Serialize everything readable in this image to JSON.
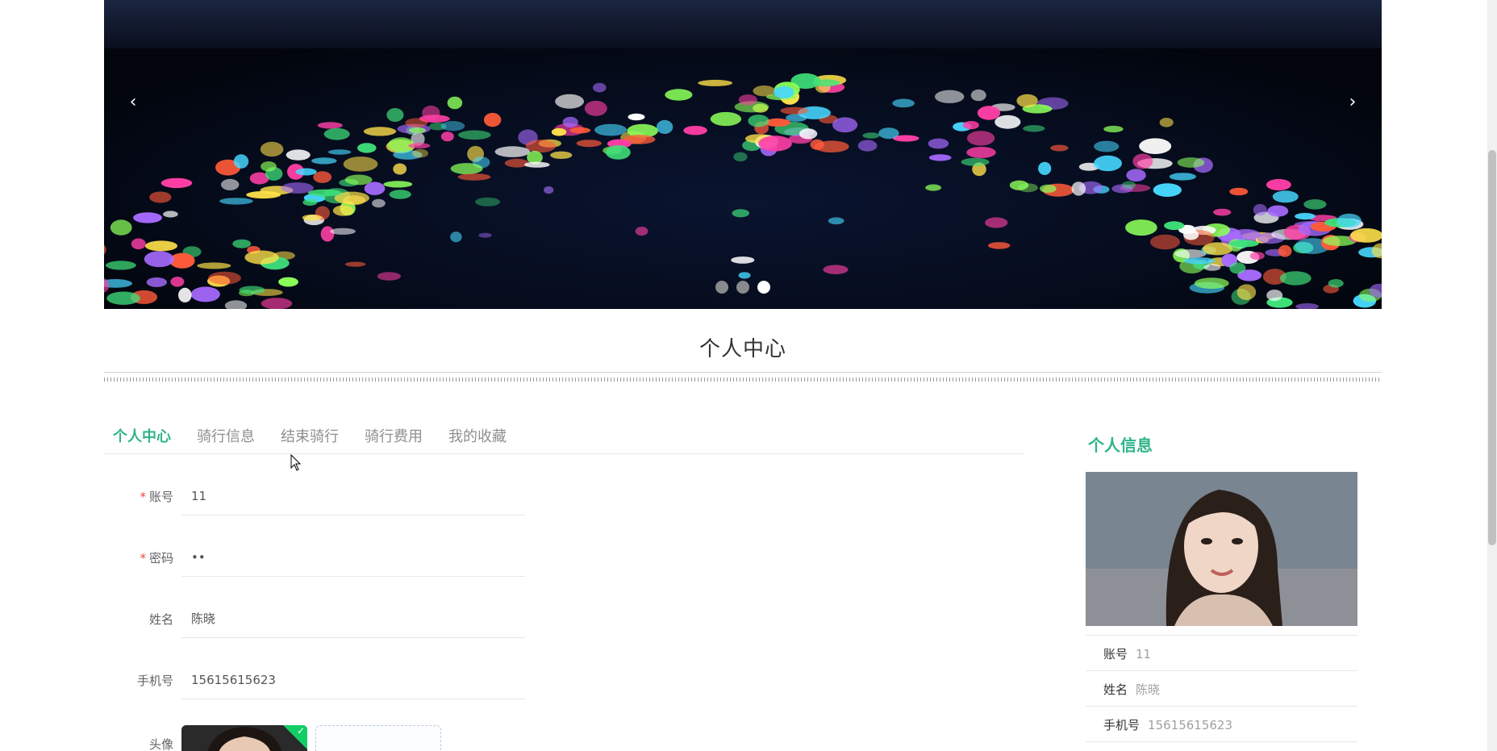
{
  "carousel": {
    "prev_icon": "‹",
    "next_icon": "›",
    "slide_count": 3,
    "active_slide": 3
  },
  "section": {
    "title": "个人中心"
  },
  "tabs": [
    {
      "label": "个人中心",
      "active": true
    },
    {
      "label": "骑行信息",
      "active": false
    },
    {
      "label": "结束骑行",
      "active": false
    },
    {
      "label": "骑行费用",
      "active": false
    },
    {
      "label": "我的收藏",
      "active": false
    }
  ],
  "form": {
    "required_mark": "*",
    "account_label": "账号",
    "account_value": "11",
    "password_label": "密码",
    "password_value": "••",
    "name_label": "姓名",
    "name_value": "陈晓",
    "phone_label": "手机号",
    "phone_value": "15615615623",
    "avatar_label": "头像"
  },
  "profile": {
    "title": "个人信息",
    "account_label": "账号",
    "account_value": "11",
    "name_label": "姓名",
    "name_value": "陈晓",
    "phone_label": "手机号",
    "phone_value": "15615615623"
  },
  "colors": {
    "accent": "#2fb48a",
    "required": "#e74c3c",
    "success": "#13ce66"
  }
}
